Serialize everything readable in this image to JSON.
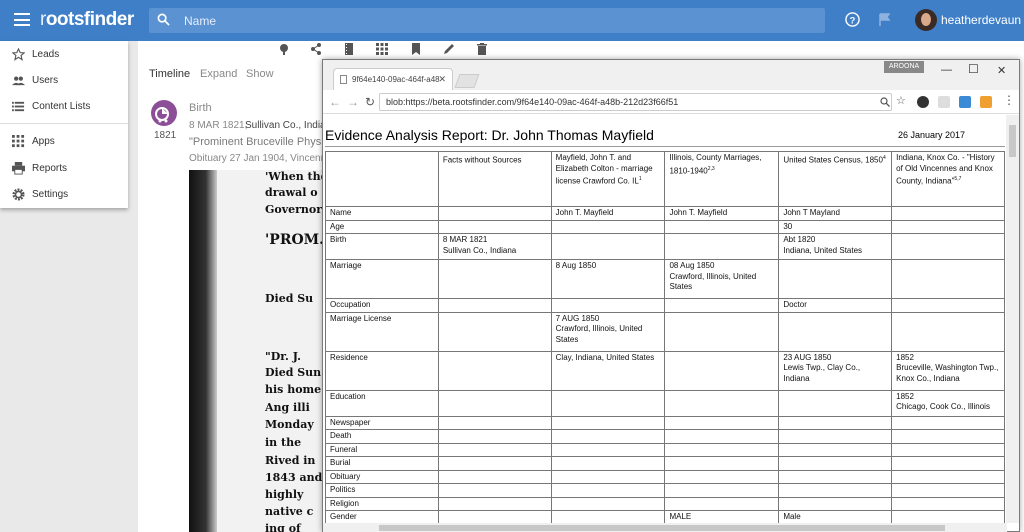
{
  "app": {
    "logo": "rootsfinder",
    "search_placeholder": "Name",
    "user_name": "heatherdevaun"
  },
  "colors": {
    "brand": "#3f7fc8",
    "event_icon": "#8d4e98"
  },
  "menu": {
    "items": [
      {
        "label": "Leads",
        "icon": "star-outline-icon"
      },
      {
        "label": "Users",
        "icon": "users-icon"
      },
      {
        "label": "Content Lists",
        "icon": "list-icon"
      },
      {
        "label": "Apps",
        "icon": "apps-grid-icon"
      },
      {
        "label": "Reports",
        "icon": "print-icon"
      },
      {
        "label": "Settings",
        "icon": "gear-icon"
      }
    ]
  },
  "tabs": [
    "Timeline",
    "Expand",
    "Show"
  ],
  "event": {
    "title": "Birth",
    "year": "1821",
    "date": "8 MAR 1821,",
    "place": "Sullivan Co., Indiana",
    "quote": "\"Prominent Bruceville Physici",
    "obituary": "Obituary 27 Jan 1904, Vincennes"
  },
  "clipping_lines": [
    "'When the",
    "drawal o",
    "Governor",
    "'PROM.",
    "Died Su",
    "\"Dr. J.",
    "Died Sun",
    "his home",
    "Ang illi",
    "Monday",
    "in the",
    "Rived in",
    "1843 and",
    "highly",
    "native c",
    "ing of"
  ],
  "browser": {
    "tab_title": "9f64e140-09ac-464f-a48",
    "badge": "AROONA",
    "url": "blob:https://beta.rootsfinder.com/9f64e140-09ac-464f-a48b-212d23f66f51"
  },
  "report": {
    "title": "Evidence Analysis Report: Dr. John Thomas Mayfield",
    "date": "26 January 2017",
    "headers": [
      {
        "text": "",
        "sup": ""
      },
      {
        "text": "Facts without Sources",
        "sup": ""
      },
      {
        "text": "Mayfield, John T. and Elizabeth Colton - marriage license Crawford Co. IL",
        "sup": "1"
      },
      {
        "text": "Illinois, County Marriages, 1810-1940",
        "sup": "2,3"
      },
      {
        "text": "United States Census, 1850",
        "sup": "4"
      },
      {
        "text": "Indiana, Knox Co. - \"History of Old Vincennes and Knox County, Indiana\"",
        "sup": "5,7"
      }
    ],
    "rows": [
      [
        "Name",
        "",
        "John T. Mayfield",
        "John T. Mayfield",
        "John T Mayland",
        ""
      ],
      [
        "Age",
        "",
        "",
        "",
        "30",
        ""
      ],
      [
        "Birth",
        "8 MAR 1821\nSullivan Co., Indiana",
        "",
        "",
        "Abt 1820\nIndiana, United States",
        ""
      ],
      [
        "Marriage",
        "",
        "8 Aug 1850",
        "08 Aug 1850\nCrawford, Illinois, United States",
        "",
        ""
      ],
      [
        "Occupation",
        "",
        "",
        "",
        "Doctor",
        ""
      ],
      [
        "Marriage License",
        "",
        "7 AUG 1850\nCrawford, Illinois, United States",
        "",
        "",
        ""
      ],
      [
        "Residence",
        "",
        "Clay, Indiana, United States",
        "",
        "23 AUG 1850\nLewis Twp., Clay Co., Indiana",
        "1852\nBruceville, Washington Twp., Knox Co., Indiana"
      ],
      [
        "Education",
        "",
        "",
        "",
        "",
        "1852\nChicago, Cook Co., Illinois"
      ],
      [
        "Newspaper",
        "",
        "",
        "",
        "",
        ""
      ],
      [
        "Death",
        "",
        "",
        "",
        "",
        ""
      ],
      [
        "Funeral",
        "",
        "",
        "",
        "",
        ""
      ],
      [
        "Burial",
        "",
        "",
        "",
        "",
        ""
      ],
      [
        "Obituary",
        "",
        "",
        "",
        "",
        ""
      ],
      [
        "Politics",
        "",
        "",
        "",
        "",
        ""
      ],
      [
        "Religion",
        "",
        "",
        "",
        "",
        ""
      ],
      [
        "Gender",
        "",
        "",
        "MALE",
        "Male",
        ""
      ]
    ]
  }
}
